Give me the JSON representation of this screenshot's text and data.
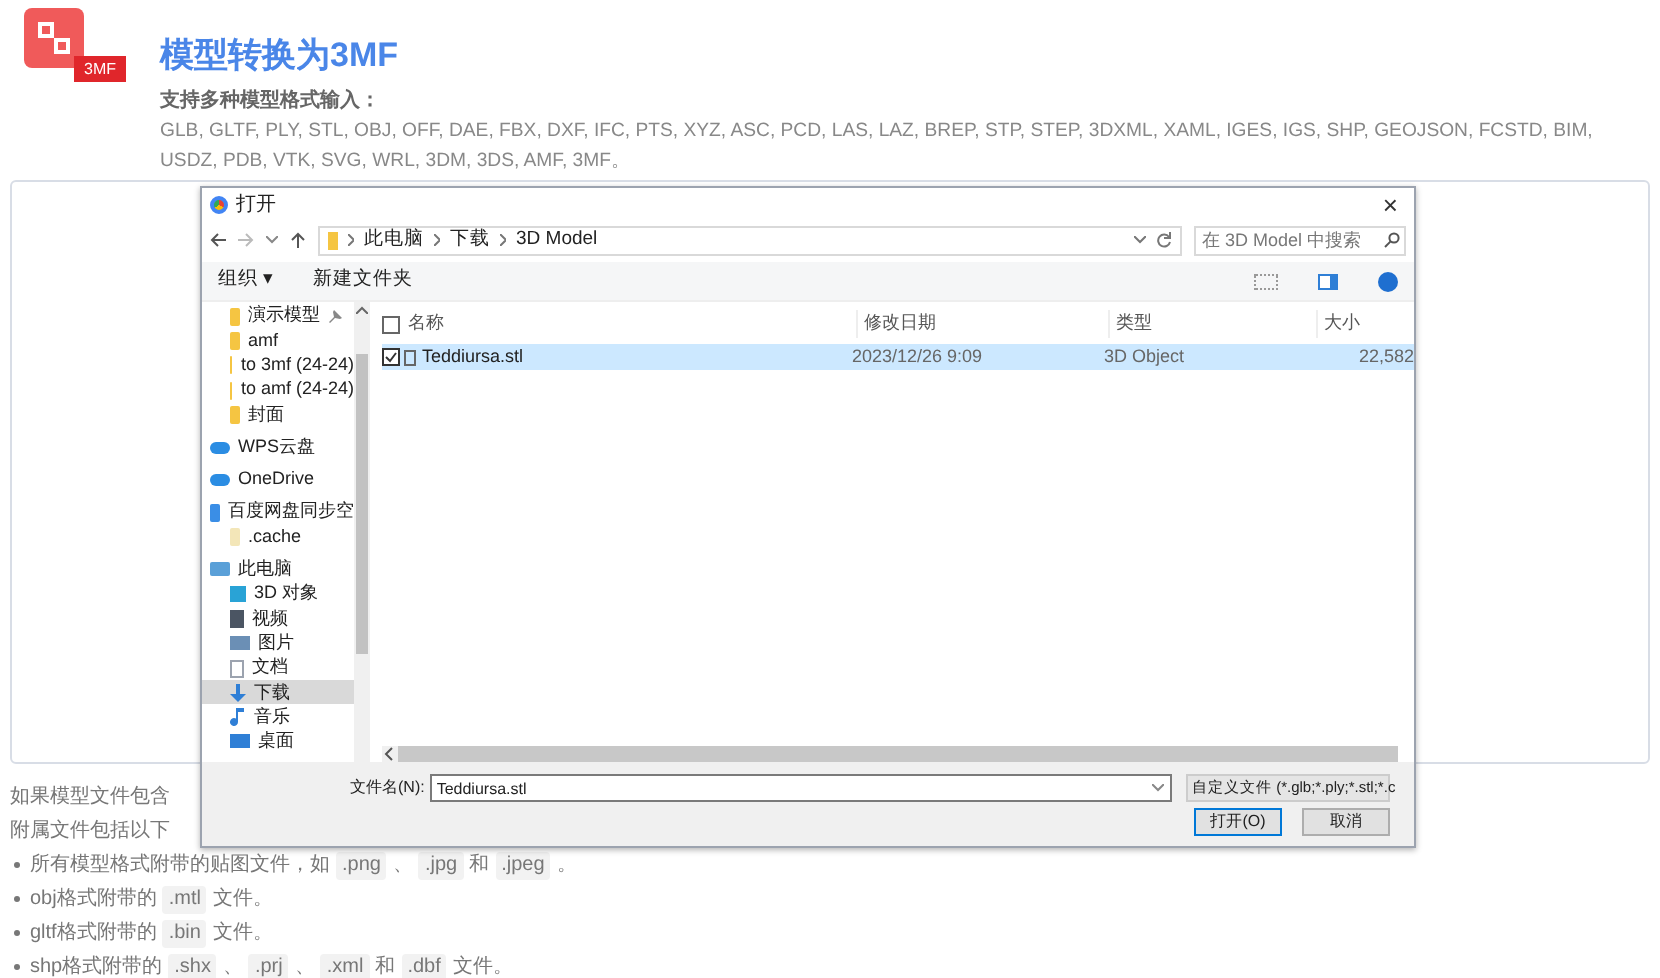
{
  "header": {
    "badge": "3MF",
    "title": "模型转换为3MF",
    "subtitle": "支持多种模型格式输入：",
    "formats": "GLB, GLTF, PLY, STL, OBJ, OFF, DAE, FBX, DXF, IFC, PTS, XYZ, ASC, PCD, LAS, LAZ, BREP, STP, STEP, 3DXML, XAML, IGES, IGS, SHP, GEOJSON, FCSTD, BIM, USDZ, PDB, VTK, SVG, WRL, 3DM, 3DS, AMF, 3MF。"
  },
  "notes": {
    "lines": [
      "如果模型文件包含",
      "附属文件包括以下"
    ],
    "bullets": [
      [
        {
          "kind": "text",
          "text": "所有模型格式附带的贴图文件，如"
        },
        {
          "kind": "code",
          "text": ".png"
        },
        {
          "kind": "text",
          "text": "、"
        },
        {
          "kind": "code",
          "text": ".jpg"
        },
        {
          "kind": "text",
          "text": "和"
        },
        {
          "kind": "code",
          "text": ".jpeg"
        },
        {
          "kind": "text",
          "text": "。"
        }
      ],
      [
        {
          "kind": "text",
          "text": "obj格式附带的"
        },
        {
          "kind": "code",
          "text": ".mtl"
        },
        {
          "kind": "text",
          "text": "文件。"
        }
      ],
      [
        {
          "kind": "text",
          "text": "gltf格式附带的"
        },
        {
          "kind": "code",
          "text": ".bin"
        },
        {
          "kind": "text",
          "text": "文件。"
        }
      ],
      [
        {
          "kind": "text",
          "text": "shp格式附带的"
        },
        {
          "kind": "code",
          "text": ".shx"
        },
        {
          "kind": "text",
          "text": "、"
        },
        {
          "kind": "code",
          "text": ".prj"
        },
        {
          "kind": "text",
          "text": "、"
        },
        {
          "kind": "code",
          "text": ".xml"
        },
        {
          "kind": "text",
          "text": "和"
        },
        {
          "kind": "code",
          "text": ".dbf"
        },
        {
          "kind": "text",
          "text": "文件。"
        }
      ]
    ]
  },
  "dialog": {
    "title": "打开",
    "close": "×",
    "path": [
      "此电脑",
      "下载",
      "3D Model"
    ],
    "search": {
      "placeholder": "在 3D Model 中搜索"
    },
    "toolbar": {
      "organize": "组织 ▾",
      "new_folder": "新建文件夹"
    },
    "sidebar": [
      {
        "kind": "folder",
        "label": "演示模型",
        "selected": false,
        "pinned": true
      },
      {
        "kind": "folder",
        "label": "amf",
        "selected": false,
        "pinned": false
      },
      {
        "kind": "folder",
        "label": "to 3mf (24-24)",
        "selected": false,
        "pinned": false
      },
      {
        "kind": "folder",
        "label": "to amf (24-24)",
        "selected": false,
        "pinned": false
      },
      {
        "kind": "folder",
        "label": "封面",
        "selected": false,
        "pinned": false
      },
      {
        "kind": "cloud",
        "label": "WPS云盘",
        "selected": false,
        "pinned": false
      },
      {
        "kind": "cloud",
        "label": "OneDrive",
        "selected": false,
        "pinned": false
      },
      {
        "kind": "drive",
        "label": "百度网盘同步空",
        "selected": false,
        "pinned": false
      },
      {
        "kind": "file",
        "label": ".cache",
        "selected": false,
        "pinned": false
      },
      {
        "kind": "pc",
        "label": "此电脑",
        "selected": false,
        "pinned": false
      },
      {
        "kind": "cube",
        "label": "3D 对象",
        "selected": false,
        "pinned": false
      },
      {
        "kind": "video",
        "label": "视频",
        "selected": false,
        "pinned": false
      },
      {
        "kind": "picture",
        "label": "图片",
        "selected": false,
        "pinned": false
      },
      {
        "kind": "doc",
        "label": "文档",
        "selected": false,
        "pinned": false
      },
      {
        "kind": "download",
        "label": "下载",
        "selected": true,
        "pinned": false
      },
      {
        "kind": "music",
        "label": "音乐",
        "selected": false,
        "pinned": false
      },
      {
        "kind": "desktop",
        "label": "桌面",
        "selected": false,
        "pinned": false
      }
    ],
    "select_all": {
      "checked": false
    },
    "columns": [
      "名称",
      "修改日期",
      "类型",
      "大小"
    ],
    "files": [
      {
        "name": "Teddiursa.stl",
        "date": "2023/12/26 9:09",
        "type": "3D Object",
        "size": "22,582",
        "selected": true,
        "checked": true
      }
    ],
    "filename_label": "文件名(N):",
    "filename": "Teddiursa.stl",
    "filetype": "自定义文件 (*.glb;*.ply;*.stl;*.c",
    "buttons": [
      "打开(O)",
      "取消"
    ]
  }
}
